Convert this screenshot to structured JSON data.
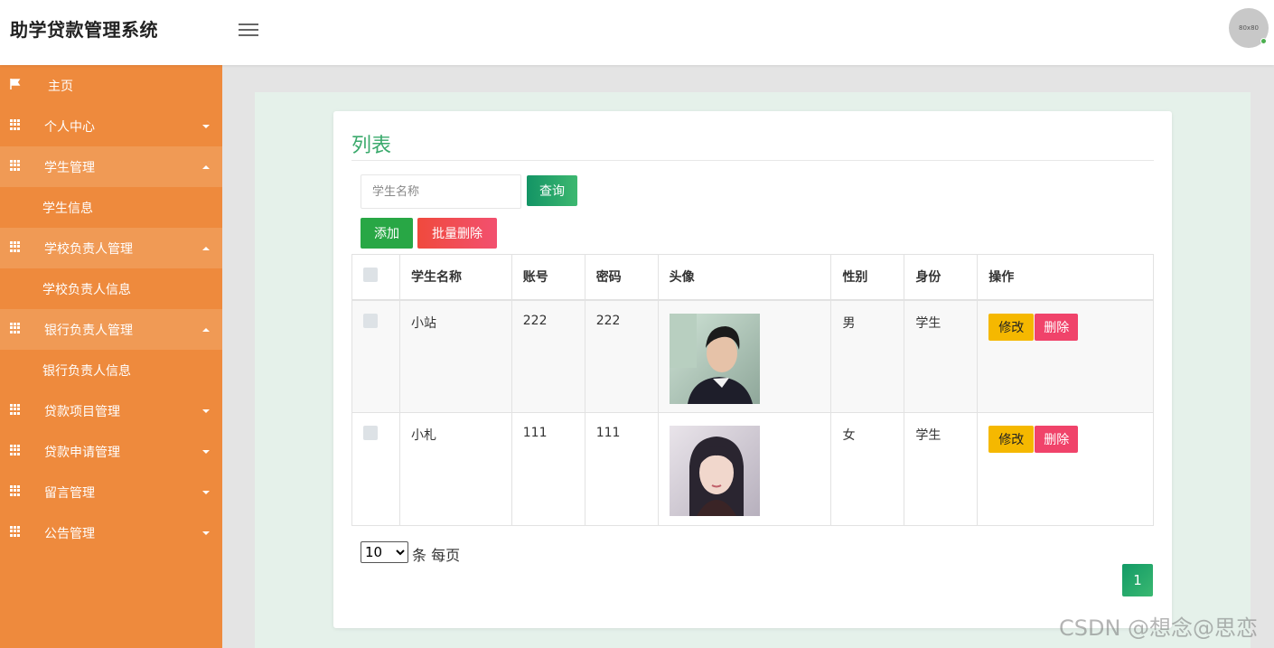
{
  "app": {
    "title": "助学贷款管理系统",
    "avatar_label": "80x80"
  },
  "sidebar": {
    "items": [
      {
        "label": "主页",
        "icon": "flag-icon"
      },
      {
        "label": "个人中心",
        "icon": "grid-icon",
        "expanded": false
      },
      {
        "label": "学生管理",
        "icon": "grid-icon",
        "expanded": true
      },
      {
        "label": "学生信息",
        "sub": true
      },
      {
        "label": "学校负责人管理",
        "icon": "grid-icon",
        "expanded": true
      },
      {
        "label": "学校负责人信息",
        "sub": true
      },
      {
        "label": "银行负责人管理",
        "icon": "grid-icon",
        "expanded": true
      },
      {
        "label": "银行负责人信息",
        "sub": true
      },
      {
        "label": "贷款项目管理",
        "icon": "grid-icon",
        "expanded": false
      },
      {
        "label": "贷款申请管理",
        "icon": "grid-icon",
        "expanded": false
      },
      {
        "label": "留言管理",
        "icon": "grid-icon",
        "expanded": false
      },
      {
        "label": "公告管理",
        "icon": "grid-icon",
        "expanded": false
      }
    ]
  },
  "main": {
    "card_title": "列表",
    "search": {
      "placeholder": "学生名称",
      "value": ""
    },
    "buttons": {
      "query": "查询",
      "add": "添加",
      "batch_delete": "批量删除"
    },
    "table": {
      "headers": [
        "学生名称",
        "账号",
        "密码",
        "头像",
        "性别",
        "身份",
        "操作"
      ],
      "rows": [
        {
          "name": "小站",
          "account": "222",
          "password": "222",
          "gender": "男",
          "role": "学生"
        },
        {
          "name": "小札",
          "account": "111",
          "password": "111",
          "gender": "女",
          "role": "学生"
        }
      ],
      "actions": {
        "edit": "修改",
        "delete": "删除"
      }
    },
    "pagination": {
      "page_size": "10",
      "page_size_options": [
        "10"
      ],
      "page_size_label": "条 每页",
      "current_page": "1"
    }
  },
  "watermark": "CSDN @想念@思恋",
  "colors": {
    "sidebar": "#ee8a3d",
    "accent_green": "#3aaa6c",
    "delete_red": "#f0436a",
    "edit_yellow": "#f5b800"
  }
}
